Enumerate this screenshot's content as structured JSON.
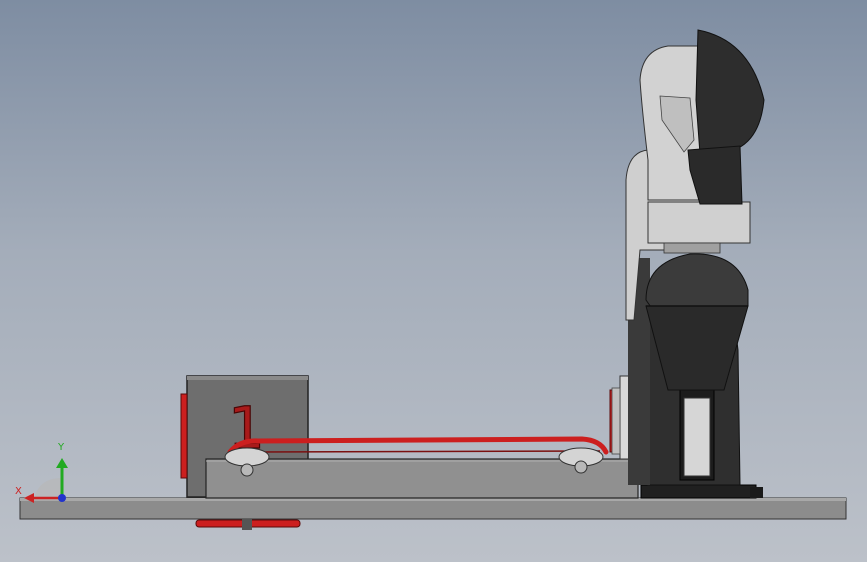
{
  "viewport": {
    "colors": {
      "background_top": "#7e8da2",
      "background_bottom": "#bcc1c9",
      "accent_red": "#cc1f1f",
      "dark_gray": "#2f2f2f",
      "light_gray": "#cfcfcf"
    }
  },
  "model": {
    "box_label": "1"
  },
  "triad": {
    "x_label": "X",
    "y_label": "Y",
    "x_color": "#cc2222",
    "y_color": "#22aa22",
    "z_color": "#2233cc"
  }
}
